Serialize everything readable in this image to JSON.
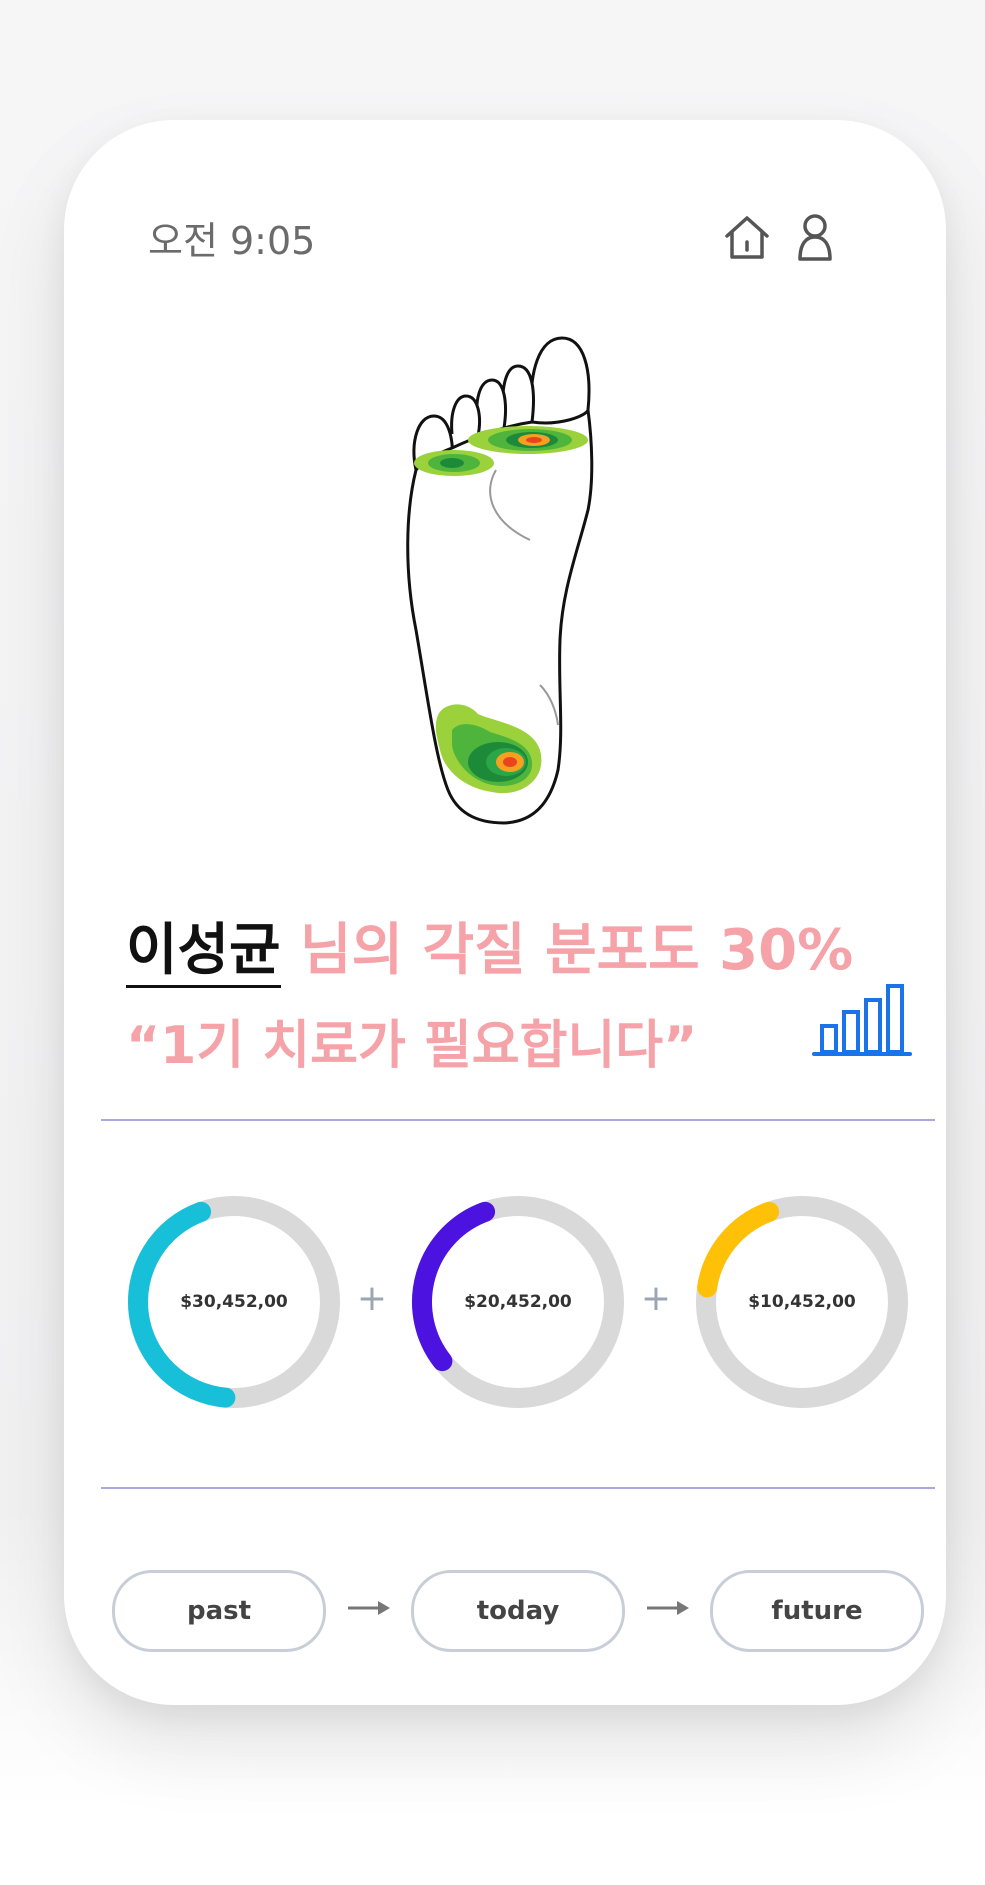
{
  "status_bar": {
    "time": "오전 9:05",
    "home_icon": "home-icon",
    "user_icon": "user-icon"
  },
  "illustration": {
    "icon": "foot-heatmap",
    "colors": {
      "outline": "#111111",
      "green_light": "#9bd23c",
      "green_dark": "#1d8a3a",
      "orange": "#f5a020",
      "red": "#e8451e"
    }
  },
  "result": {
    "name": "이성균",
    "distribution_text": " 님의 각질 분포도 30%",
    "recommendation": "“1기 치료가 필요합니다”",
    "chart_icon": "bar-chart-icon",
    "accent_color": "#f5a3a8",
    "icon_color": "#1a73e8"
  },
  "rings": [
    {
      "label": "$30,452,00",
      "color": "#18bfd8",
      "fraction": 0.43
    },
    {
      "label": "$20,452,00",
      "color": "#4b12e0",
      "fraction": 0.3
    },
    {
      "label": "$10,452,00",
      "color": "#ffc107",
      "fraction": 0.17
    }
  ],
  "ring_track_color": "#d9d9d9",
  "plus_sign": "+",
  "timeline": {
    "past": "past",
    "today": "today",
    "future": "future"
  }
}
